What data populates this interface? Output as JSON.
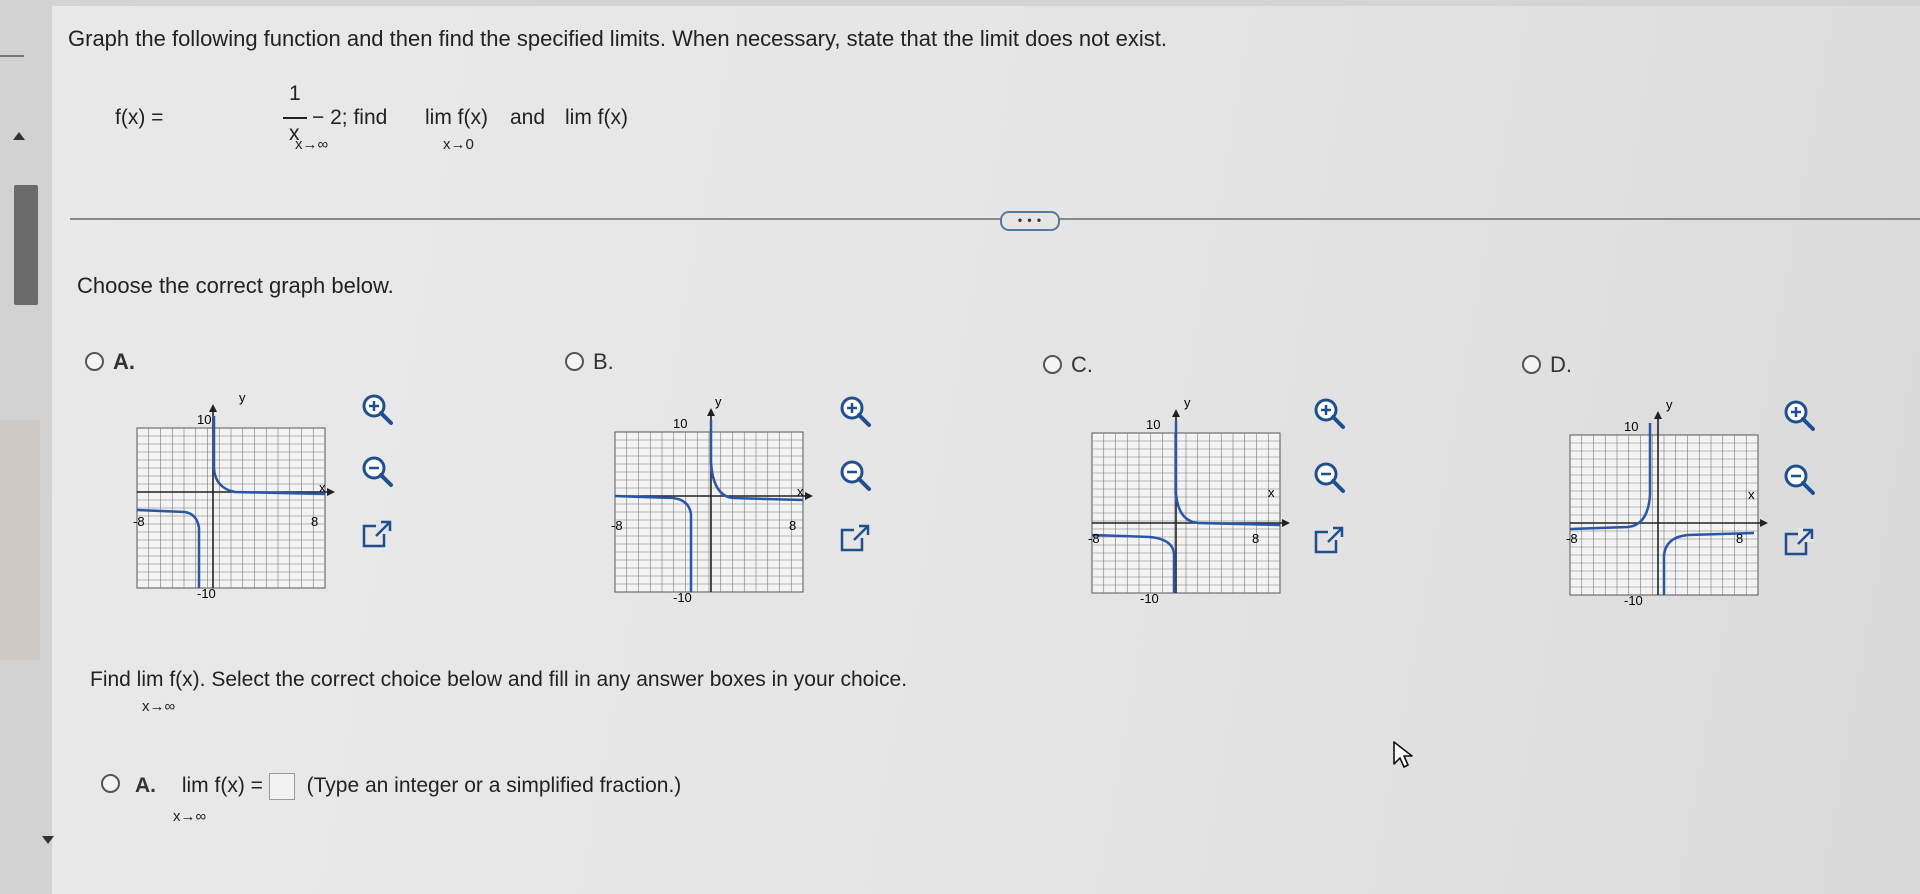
{
  "question": "Graph the following function and then find the specified limits. When necessary, state that the limit does not exist.",
  "function": {
    "lhs": "f(x) =",
    "numerator": "1",
    "denominator": "x",
    "rest": "− 2; find",
    "lim1": "lim  f(x)",
    "and": "and",
    "lim2": "lim  f(x)",
    "lim1_sub": "x→∞",
    "lim2_sub": "x→0"
  },
  "more_button": "• • •",
  "choose_prompt": "Choose the correct graph below.",
  "options": [
    {
      "label": "A."
    },
    {
      "label": "B."
    },
    {
      "label": "C."
    },
    {
      "label": "D."
    }
  ],
  "graph_labels": {
    "y": "y",
    "x": "x",
    "ymax": "10",
    "ymin": "-10",
    "xmin": "-8",
    "xmax": "8"
  },
  "find_prompt": {
    "text": "Find  lim  f(x). Select the correct choice below and fill in any answer boxes in your choice.",
    "sub": "x→∞"
  },
  "answer": {
    "label": "A.",
    "expr": "lim  f(x) =",
    "sub": "x→∞",
    "hint": "(Type an integer or a simplified fraction.)"
  },
  "icons": [
    "zoom-in-icon",
    "zoom-out-icon",
    "open-external-icon",
    "pointer-cursor-icon"
  ]
}
